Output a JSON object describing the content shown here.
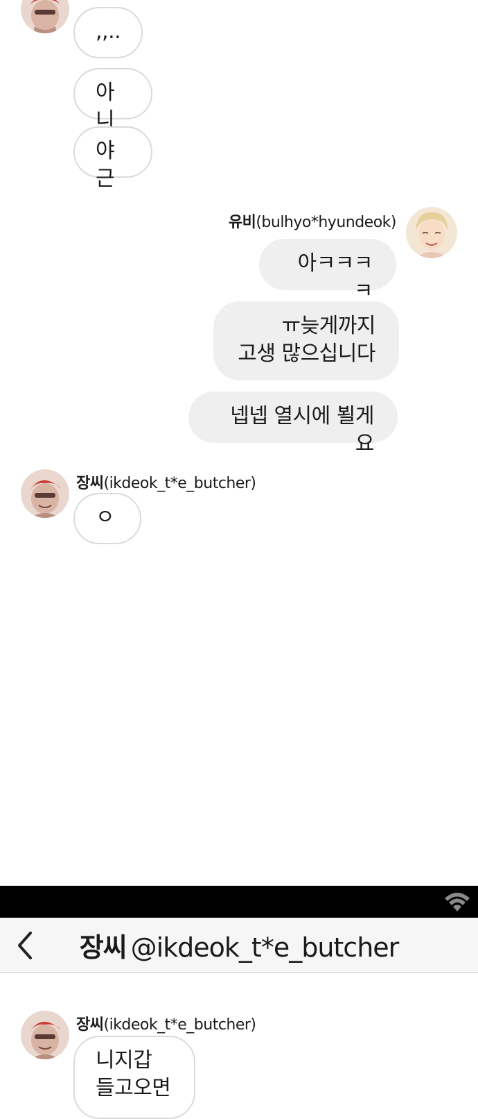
{
  "colors": {
    "incoming_bubble_bg": "#ffffff",
    "incoming_bubble_border": "#dadada",
    "outgoing_bubble_bg": "#efefef",
    "status_bar": "#000000",
    "header_bg": "#f6f6f6"
  },
  "feed": {
    "top_group": {
      "messages": [
        ",,..",
        "아니",
        "야근"
      ]
    },
    "yubi_group": {
      "sender_name": "유비",
      "sender_handle": "(bulhyo*hyundeok)",
      "avatar_icon": "blonde-man-avatar",
      "messages": [
        "아ㅋㅋㅋㅋ",
        "ㅠ늦게까지\n고생 많으십니다",
        "넵넵 열시에 뵐게요"
      ]
    },
    "jang_group": {
      "sender_name": "장씨",
      "sender_handle": "(ikdeok_t*e_butcher)",
      "avatar_icon": "red-hair-man-avatar",
      "messages": [
        "ㅇ"
      ]
    }
  },
  "status_bar": {
    "wifi_icon": "wifi-icon"
  },
  "chat_header": {
    "back_icon": "chevron-left-icon",
    "name": "장씨",
    "handle": "@ikdeok_t*e_butcher"
  },
  "chat": {
    "sender_name": "장씨",
    "sender_handle": "(ikdeok_t*e_butcher)",
    "avatar_icon": "red-hair-man-avatar",
    "messages": [
      "니지갑\n들고오면"
    ]
  }
}
